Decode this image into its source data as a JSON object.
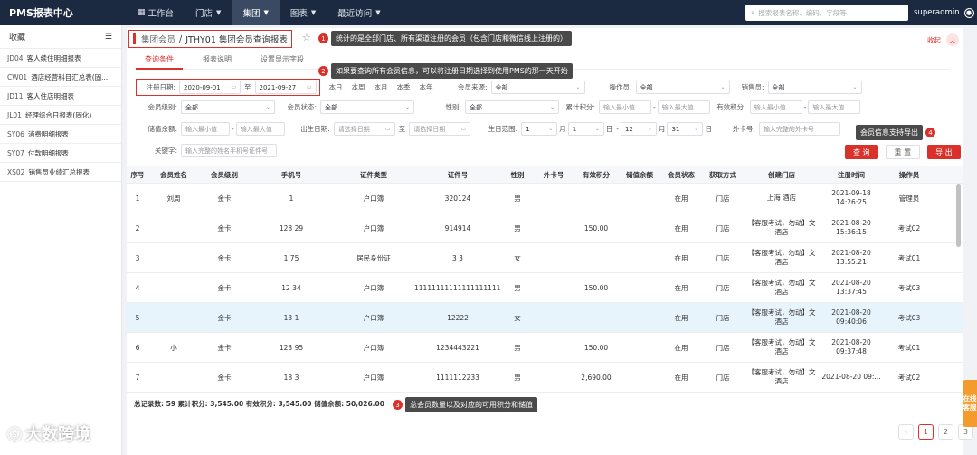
{
  "topbar": {
    "brand": "PMS报表中心",
    "nav": [
      {
        "label": "工作台",
        "icon": "grid-icon"
      },
      {
        "label": "门店",
        "caret": "⌄"
      },
      {
        "label": "集团",
        "caret": "⌄"
      },
      {
        "label": "图表",
        "caret": "⌄"
      },
      {
        "label": "最近访问",
        "caret": "⌄"
      }
    ],
    "search_placeholder": "搜索报表名称、编码、字段等",
    "user": "superadmin"
  },
  "sidebar": {
    "title": "收藏",
    "items": [
      {
        "code": "JD04",
        "label": "客人续住明细报表"
      },
      {
        "code": "CW01",
        "label": "酒店经营科目汇总表(固..."
      },
      {
        "code": "JD11",
        "label": "客人住店明细表"
      },
      {
        "code": "JL01",
        "label": "经理综合日报表(固化)"
      },
      {
        "code": "SY06",
        "label": "消费明细报表"
      },
      {
        "code": "SY07",
        "label": "付款明细报表"
      },
      {
        "code": "XS02",
        "label": "销售员业绩汇总报表"
      }
    ]
  },
  "breadcrumb": {
    "group": "集团会员",
    "sep": "/",
    "current": "JTHY01 集团会员查询报表"
  },
  "callouts": {
    "c1": {
      "num": "1",
      "text": "统计的是全部门店、所有渠道注册的会员（包含门店和微信线上注册的）"
    },
    "c2": {
      "num": "2",
      "text": "如果要查询所有会员信息，可以将注册日期选择到使用PMS的那一天开始"
    },
    "c3": {
      "num": "3",
      "text": "总会员数量以及对应的可用积分和储值"
    },
    "c4": {
      "num": "4",
      "text": "会员信息支持导出"
    }
  },
  "collapse_label": "收起",
  "tabs": [
    "查询条件",
    "报表说明",
    "设置显示字段"
  ],
  "filters": {
    "reg_date_label": "注册日期:",
    "reg_date_from": "2020-09-01",
    "to": "至",
    "reg_date_to": "2021-09-27",
    "quick": [
      "本日",
      "本周",
      "本月",
      "本季",
      "本年"
    ],
    "source_label": "会员来源:",
    "source_value": "全部",
    "operator_label": "操作员:",
    "operator_value": "全部",
    "sales_label": "销售员:",
    "sales_value": "全部",
    "level_label": "会员级别:",
    "level_value": "全部",
    "status_label": "会员状态:",
    "status_value": "全部",
    "gender_label": "性别:",
    "gender_value": "全部",
    "total_points_label": "累计积分:",
    "min_ph": "输入最小值",
    "max_ph": "输入最大值",
    "valid_points_label": "有效积分:",
    "stored_label": "储值余额:",
    "birth_date_label": "出生日期:",
    "date_ph": "请选择日期",
    "birth_range_label": "生日范围:",
    "birth_m1": "1",
    "birth_d1": "1",
    "birth_m2": "12",
    "birth_d2": "31",
    "month": "月",
    "day": "日",
    "dash": "-",
    "card_label": "外卡号:",
    "card_ph": "输入完整的外卡号",
    "keyword_label": "关键字:",
    "keyword_ph": "输入完整的姓名手机号证件号",
    "query_btn": "查 询",
    "reset_btn": "重 置",
    "export_btn": "导 出"
  },
  "table": {
    "headers": [
      "序号",
      "会员姓名",
      "会员级别",
      "手机号",
      "证件类型",
      "证件号",
      "性别",
      "外卡号",
      "有效积分",
      "储值余额",
      "会员状态",
      "获取方式",
      "创建门店",
      "注册时间",
      "操作员"
    ],
    "rows": [
      {
        "no": "1",
        "name": "刘周",
        "level": "金卡",
        "phone": "1",
        "idtype": "户口簿",
        "idno": "320124",
        "gender": "男",
        "card": "",
        "points": "",
        "stored": "",
        "status": "在用",
        "method": "门店",
        "store": "上海    酒店",
        "time": "2021-09-18 14:26:25",
        "op": "管理员"
      },
      {
        "no": "2",
        "name": "",
        "level": "金卡",
        "phone": "128    29",
        "idtype": "户口簿",
        "idno": "914914",
        "gender": "男",
        "card": "",
        "points": "150.00",
        "stored": "",
        "status": "在用",
        "method": "门店",
        "store": "【客服考试，勿动】文    酒店",
        "time": "2021-08-20 15:36:15",
        "op": "考试02"
      },
      {
        "no": "3",
        "name": "",
        "level": "金卡",
        "phone": "1    75",
        "idtype": "居民身份证",
        "idno": "3    3",
        "gender": "女",
        "card": "",
        "points": "",
        "stored": "",
        "status": "在用",
        "method": "门店",
        "store": "【客服考试，勿动】文    酒店",
        "time": "2021-08-20 13:55:21",
        "op": "考试01"
      },
      {
        "no": "4",
        "name": "",
        "level": "金卡",
        "phone": "12    34",
        "idtype": "户口簿",
        "idno": "11111111111111111111111",
        "gender": "男",
        "card": "",
        "points": "150.00",
        "stored": "",
        "status": "在用",
        "method": "门店",
        "store": "【客服考试，勿动】文    酒店",
        "time": "2021-08-20 13:37:45",
        "op": "考试03"
      },
      {
        "no": "5",
        "name": "",
        "level": "金卡",
        "phone": "13    1",
        "idtype": "户口簿",
        "idno": "12222",
        "gender": "女",
        "card": "",
        "points": "",
        "stored": "",
        "status": "在用",
        "method": "门店",
        "store": "【客服考试，勿动】文    酒店",
        "time": "2021-08-20 09:40:06",
        "op": "考试03"
      },
      {
        "no": "6",
        "name": "小",
        "level": "金卡",
        "phone": "123    95",
        "idtype": "户口簿",
        "idno": "1234443221",
        "gender": "男",
        "card": "",
        "points": "150.00",
        "stored": "",
        "status": "在用",
        "method": "门店",
        "store": "【客服考试，勿动】文    酒店",
        "time": "2021-08-20 09:37:48",
        "op": "考试01"
      },
      {
        "no": "7",
        "name": "",
        "level": "金卡",
        "phone": "18    3",
        "idtype": "户口簿",
        "idno": "1111112233",
        "gender": "男",
        "card": "",
        "points": "2,690.00",
        "stored": "",
        "status": "在用",
        "method": "门店",
        "store": "【客服考试，勿动】文    酒店",
        "time": "2021-08-20 09:...",
        "op": "考试02"
      }
    ]
  },
  "summary": "总记录数: 59 累计积分: 3,545.00 有效积分: 3,545.00 储值余额: 50,026.00",
  "pager": [
    "‹",
    "1",
    "2",
    "3",
    "›"
  ],
  "online_service": "在线客服",
  "logo_text": "大数跨境"
}
